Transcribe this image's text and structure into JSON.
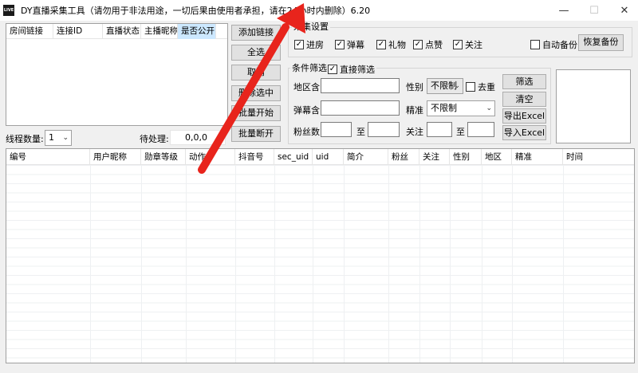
{
  "window": {
    "icon_text": "LIVE",
    "title": "DY直播采集工具（请勿用于非法用途，一切后果由使用者承担，请在24小时内删除）6.20",
    "minimize": "—",
    "maximize": "☐",
    "close": "✕"
  },
  "room_list": {
    "columns": [
      "房间链接",
      "连接ID",
      "直播状态",
      "主播昵称",
      "是否公开"
    ],
    "selected_column": "是否公开"
  },
  "side_buttons": [
    "添加链接",
    "全选",
    "取消",
    "删除选中",
    "批量开始",
    "批量断开"
  ],
  "thread": {
    "label": "线程数量:",
    "value": "1"
  },
  "pending": {
    "label": "待处理:",
    "value": "0,0,0"
  },
  "collect_settings": {
    "title": "采集设置",
    "options": [
      {
        "label": "进房",
        "checked": true
      },
      {
        "label": "弹幕",
        "checked": true
      },
      {
        "label": "礼物",
        "checked": true
      },
      {
        "label": "点赞",
        "checked": true
      },
      {
        "label": "关注",
        "checked": true
      }
    ],
    "auto_backup": {
      "label": "自动备份",
      "checked": false
    },
    "restore_button": "恢复备份"
  },
  "filter": {
    "title": "条件筛选",
    "direct": {
      "label": "直接筛选",
      "checked": true
    },
    "region_label": "地区含",
    "region_value": "",
    "gender_label": "性别",
    "gender_value": "不限制",
    "dedup": {
      "label": "去重",
      "checked": false
    },
    "danmu_label": "弹幕含",
    "danmu_value": "",
    "precise_label": "精准",
    "precise_value": "不限制",
    "fans_label": "粉丝数",
    "follow_label": "关注",
    "to_label": "至",
    "buttons": [
      "筛选",
      "清空",
      "导出Excel",
      "导入Excel"
    ]
  },
  "data_table": {
    "columns": [
      "编号",
      "用户昵称",
      "勋章等级",
      "动作",
      "抖音号",
      "sec_uid",
      "uid",
      "简介",
      "粉丝",
      "关注",
      "性别",
      "地区",
      "精准",
      "时间"
    ]
  },
  "colors": {
    "annotation_arrow": "#e8241c",
    "selected_header": "#cce8ff",
    "window_bg": "#f0f0f0"
  }
}
